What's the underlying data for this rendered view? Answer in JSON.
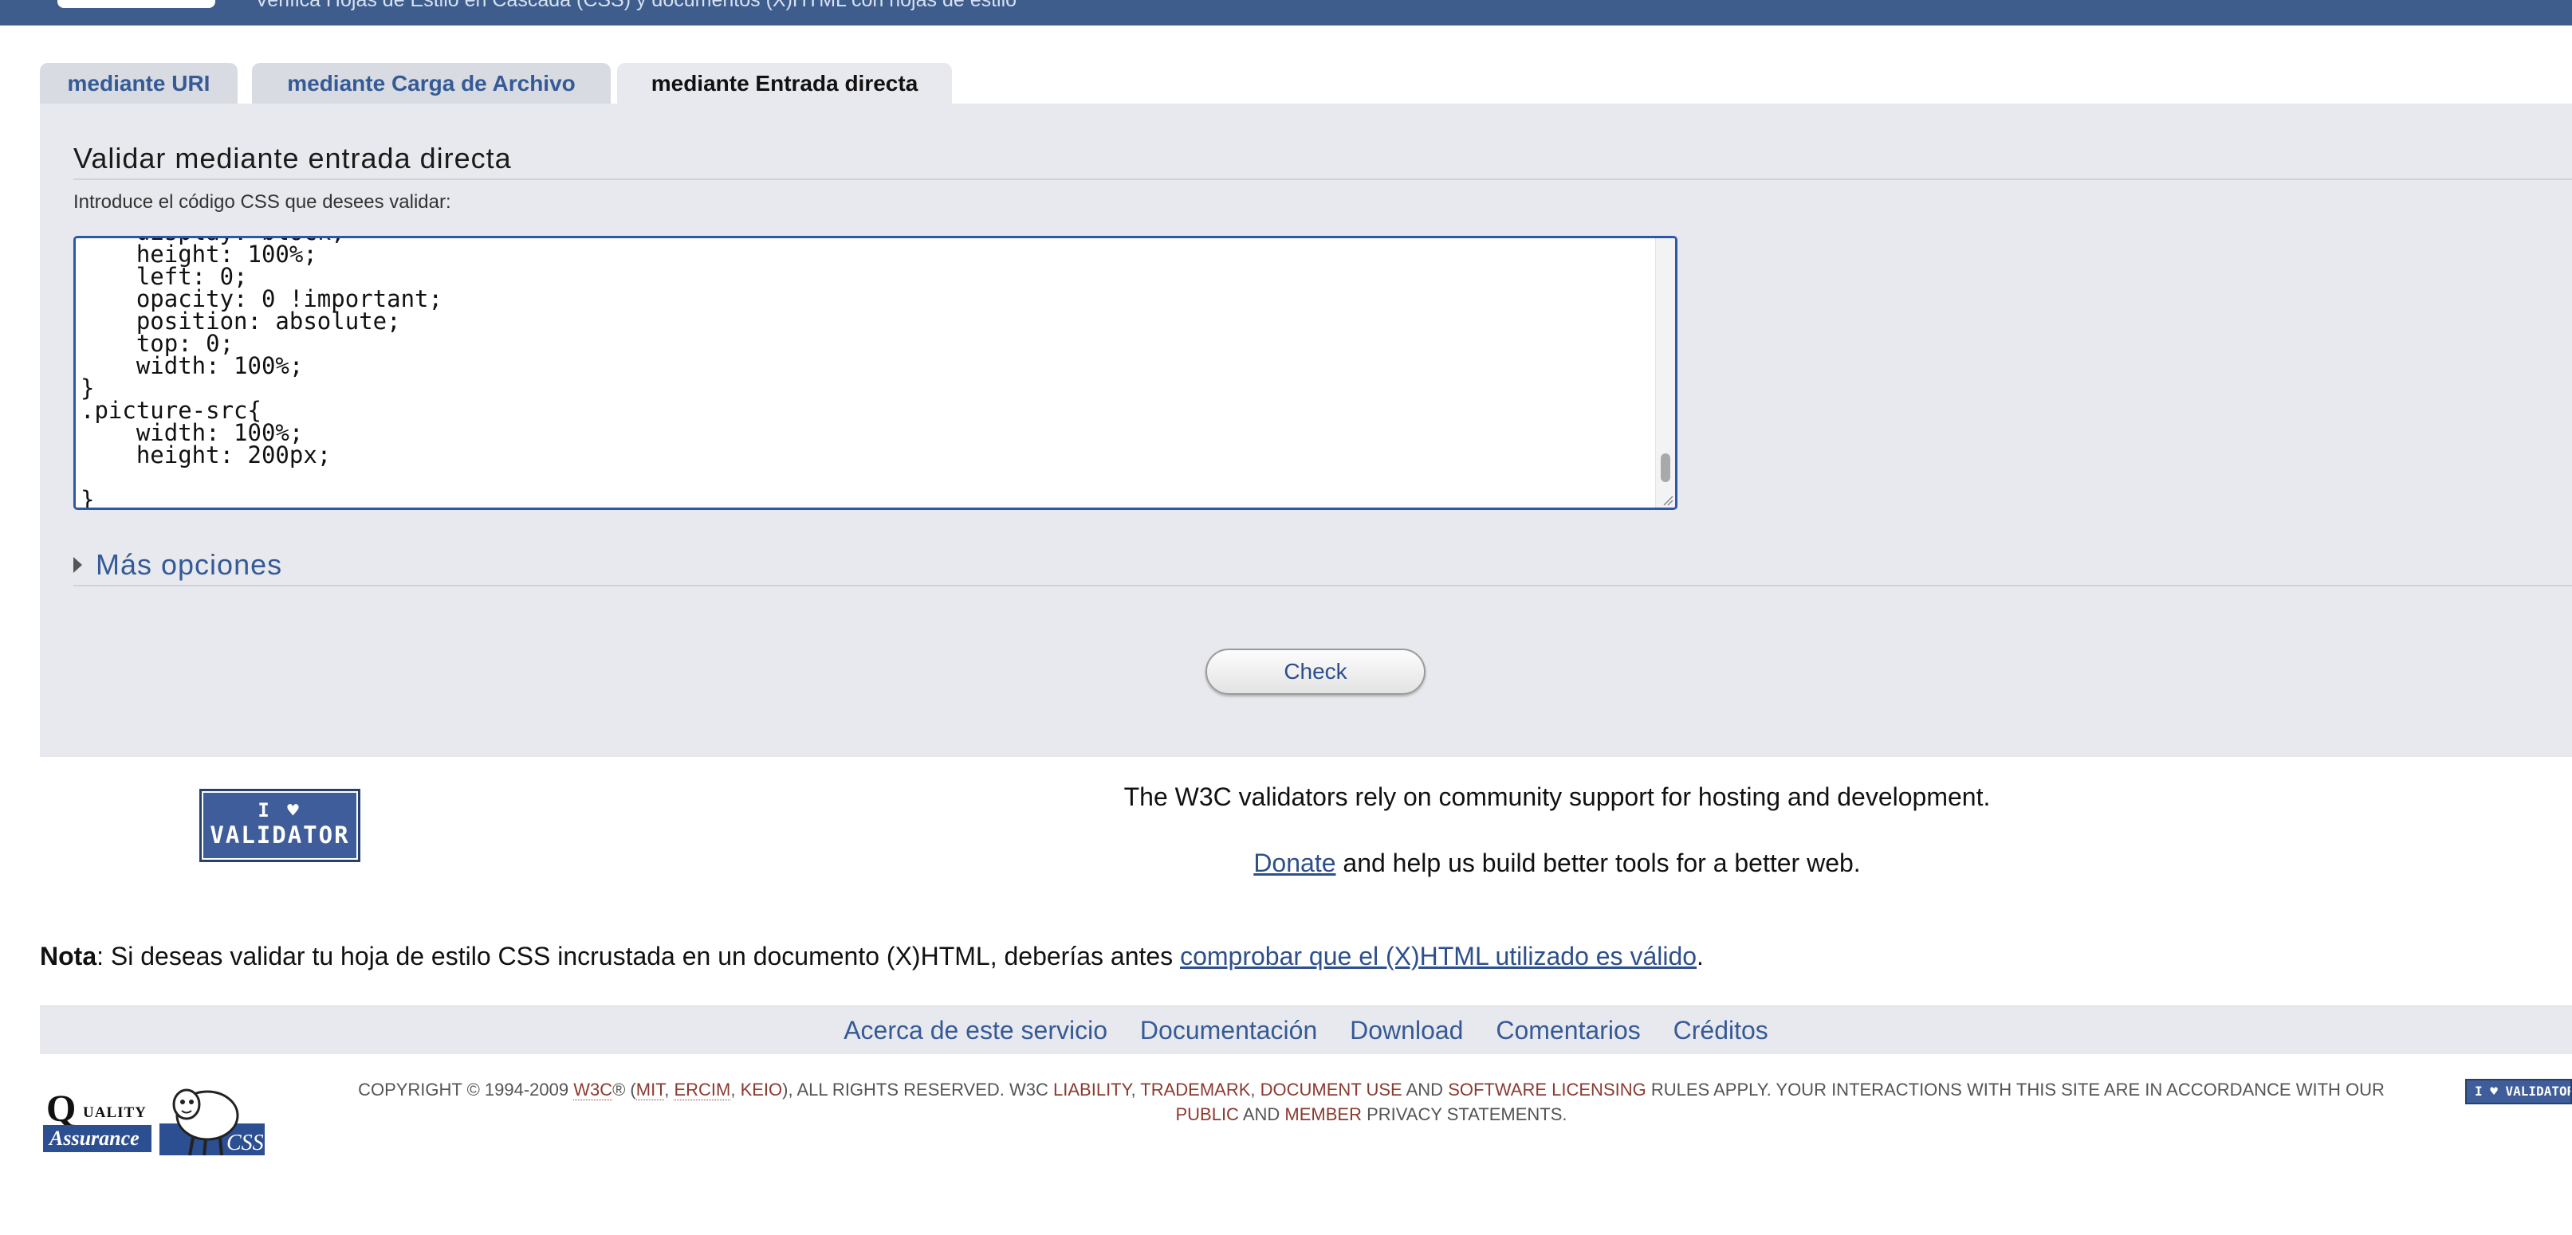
{
  "header": {
    "subtitle": "Verifica Hojas de Estilo en Cascada (CSS) y documentos (X)HTML con hojas de estilo"
  },
  "tabs": [
    {
      "label": "mediante URI"
    },
    {
      "label": "mediante Carga de Archivo"
    },
    {
      "label": "mediante Entrada directa"
    }
  ],
  "direct_input": {
    "title": "Validar mediante entrada directa",
    "instructions": "Introduce el código CSS que desees validar:",
    "code": "    display: block;\n    height: 100%;\n    left: 0;\n    opacity: 0 !important;\n    position: absolute;\n    top: 0;\n    width: 100%;\n}\n.picture-src{\n    width: 100%;\n    height: 200px;\n\n}"
  },
  "more_options": {
    "label": "Más opciones"
  },
  "check_button": {
    "label": "Check"
  },
  "badge": {
    "line1": "I ♥",
    "line2": "VALIDATOR"
  },
  "support": {
    "line1": "The W3C validators rely on community support for hosting and development.",
    "donate_link": "Donate",
    "line2_rest": " and help us build better tools for a better web."
  },
  "note": {
    "bold": "Nota",
    "text": ": Si deseas validar tu hoja de estilo CSS incrustada en un documento (X)HTML, deberías antes ",
    "link": "comprobar que el (X)HTML utilizado es válido",
    "end": "."
  },
  "footer_links": [
    {
      "label": "Acerca de este servicio"
    },
    {
      "label": "Documentación"
    },
    {
      "label": "Download"
    },
    {
      "label": "Comentarios"
    },
    {
      "label": "Créditos"
    }
  ],
  "qa_logo": {
    "q": "Q",
    "uality": "UALITY",
    "assurance": "Assurance"
  },
  "sheep_logo": {
    "text": "CSS"
  },
  "copyright": {
    "part1": "Copyright © 1994-2009 ",
    "w3c": "W3C",
    "part2": "® (",
    "mit": "MIT",
    "sep1": ", ",
    "ercim": "ERCIM",
    "sep2": ", ",
    "keio": "Keio",
    "part3": "), All Rights Reserved. W3C ",
    "liability": "liability",
    "sep3": ", ",
    "trademark": "trademark",
    "sep4": ", ",
    "document_use": "document use",
    "and1": " and ",
    "software_licensing": "software licensing",
    "part4": " rules apply. Your interactions with this site are in accordance with our ",
    "public": "public",
    "and2": " and ",
    "member": "Member",
    "part5": " privacy statements."
  },
  "mini_badge": {
    "text": "I ♥ VALIDATOR"
  },
  "colors": {
    "header_bg": "#3e5d8d",
    "panel_bg": "#e8e9ee",
    "link": "#355a96",
    "legal_link": "#8b3a2f"
  }
}
